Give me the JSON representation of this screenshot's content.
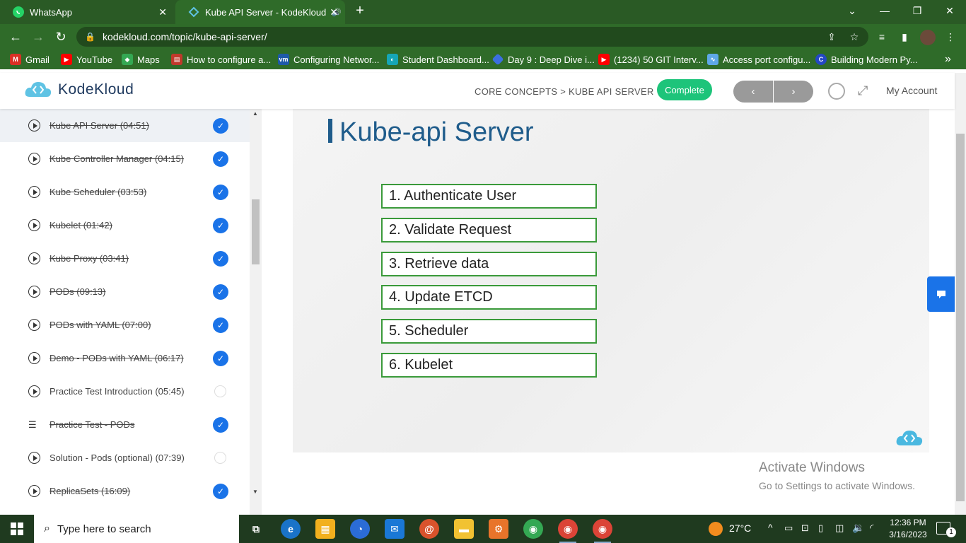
{
  "browser": {
    "tabs": [
      {
        "label": "WhatsApp",
        "icon": "whatsapp-icon"
      },
      {
        "label": "Kube API Server - KodeKloud",
        "icon": "kodekloud-icon",
        "audio": true
      }
    ],
    "url": "kodekloud.com/topic/kube-api-server/",
    "bookmarks": [
      {
        "label": "Gmail",
        "icon": "gmail-icon",
        "color": "#d93025"
      },
      {
        "label": "YouTube",
        "icon": "youtube-icon",
        "color": "#ff0000"
      },
      {
        "label": "Maps",
        "icon": "maps-icon",
        "color": "#34a853"
      },
      {
        "label": "How to configure a...",
        "icon": "page-icon",
        "color": "#c0392b"
      },
      {
        "label": "Configuring Networ...",
        "icon": "vmware-icon",
        "color": "#1e5aa8"
      },
      {
        "label": "Student Dashboard...",
        "icon": "dashboard-icon",
        "color": "#16a6b6"
      },
      {
        "label": "Day 9 : Deep Dive i...",
        "icon": "diamond-icon",
        "color": "#3b6fe0"
      },
      {
        "label": "(1234) 50 GIT Interv...",
        "icon": "youtube-icon",
        "color": "#ff0000"
      },
      {
        "label": "Access port configu...",
        "icon": "link-icon",
        "color": "#5fa8e8"
      },
      {
        "label": "Building Modern Py...",
        "icon": "c-icon",
        "color": "#2448c4"
      }
    ]
  },
  "header": {
    "logo_text": "KodeKloud",
    "breadcrumb": "CORE CONCEPTS > KUBE API SERVER",
    "complete_label": "Complete",
    "prev_label": "‹",
    "next_label": "›",
    "account_label": "My Account"
  },
  "sidebar": {
    "lessons": [
      {
        "title": "Kube API Server (04:51)",
        "type": "video",
        "done": true,
        "active": true
      },
      {
        "title": "Kube Controller Manager (04:15)",
        "type": "video",
        "done": true
      },
      {
        "title": "Kube Scheduler (03:53)",
        "type": "video",
        "done": true
      },
      {
        "title": "Kubelet (01:42)",
        "type": "video",
        "done": true
      },
      {
        "title": "Kube Proxy (03:41)",
        "type": "video",
        "done": true
      },
      {
        "title": "PODs (09:13)",
        "type": "video",
        "done": true
      },
      {
        "title": "PODs with YAML (07:00)",
        "type": "video",
        "done": true
      },
      {
        "title": "Demo - PODs with YAML (06:17)",
        "type": "video",
        "done": true
      },
      {
        "title": "Practice Test Introduction (05:45)",
        "type": "video",
        "done": false
      },
      {
        "title": "Practice Test - PODs",
        "type": "quiz",
        "done": true
      },
      {
        "title": "Solution - Pods (optional) (07:39)",
        "type": "video",
        "done": false
      },
      {
        "title": "ReplicaSets (16:09)",
        "type": "video",
        "done": true
      }
    ]
  },
  "slide": {
    "title": "Kube-api Server",
    "steps": [
      "1. Authenticate User",
      "2. Validate Request",
      "3. Retrieve data",
      "4. Update ETCD",
      "5. Scheduler",
      "6. Kubelet"
    ]
  },
  "watermark": {
    "line1": "Activate Windows",
    "line2": "Go to Settings to activate Windows."
  },
  "taskbar": {
    "search_placeholder": "Type here to search",
    "temperature": "27°C",
    "time": "12:36 PM",
    "date": "3/16/2023",
    "notification_count": "1"
  },
  "colors": {
    "browser_frame": "#2f6b29",
    "accent_blue": "#1a73e8",
    "complete_green": "#1dc47a",
    "slide_title": "#1f5c8b",
    "step_border": "#3a9a3a"
  }
}
